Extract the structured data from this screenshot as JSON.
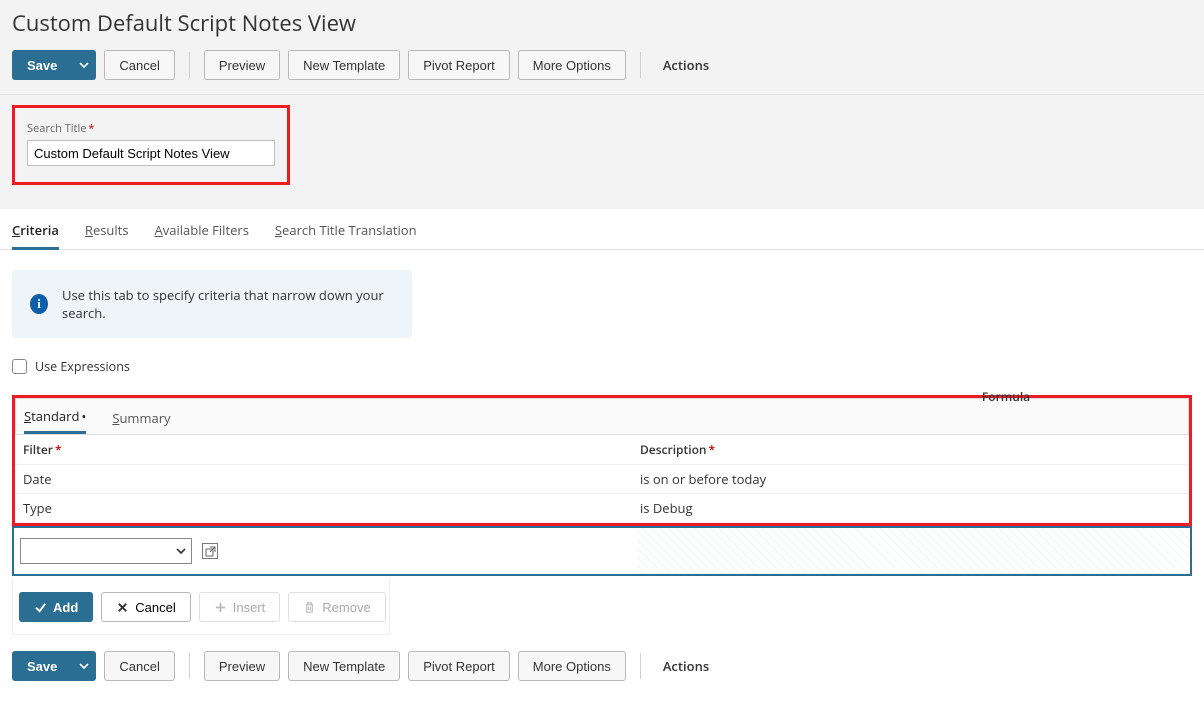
{
  "page": {
    "title": "Custom Default Script Notes View"
  },
  "toolbar": {
    "save": "Save",
    "cancel": "Cancel",
    "preview": "Preview",
    "new_template": "New Template",
    "pivot_report": "Pivot Report",
    "more_options": "More Options",
    "actions": "Actions"
  },
  "search_title": {
    "label": "Search Title",
    "value": "Custom Default Script Notes View"
  },
  "tabs": {
    "criteria": "Criteria",
    "results": "Results",
    "available_filters": "Available Filters",
    "translation": "Search Title Translation"
  },
  "info_text": "Use this tab to specify criteria that narrow down your search.",
  "use_expressions_label": "Use Expressions",
  "subtabs": {
    "standard": "Standard",
    "summary": "Summary"
  },
  "grid": {
    "headers": {
      "filter": "Filter",
      "description": "Description",
      "formula": "Formula"
    },
    "rows": [
      {
        "filter": "Date",
        "description": "is on or before today"
      },
      {
        "filter": "Type",
        "description": "is Debug"
      }
    ]
  },
  "row_actions": {
    "add": "Add",
    "cancel": "Cancel",
    "insert": "Insert",
    "remove": "Remove"
  }
}
